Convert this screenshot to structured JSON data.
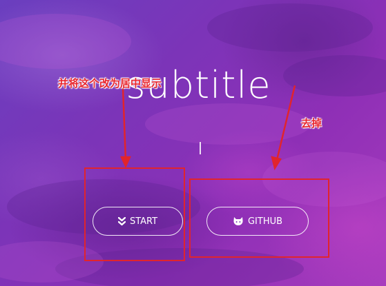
{
  "hero": {
    "subtitle": "subtitle"
  },
  "buttons": {
    "start_label": "START",
    "github_label": "GITHUB"
  },
  "annotations": {
    "center_note": "并将这个改为居中显示",
    "remove_note": "去掉",
    "color": "#e1242c"
  },
  "icons": {
    "start_icon": "double-chevron-down-icon",
    "github_icon": "github-icon"
  },
  "colors": {
    "background_primary": "#7c34b8",
    "background_accent": "#a73bbd",
    "text": "#ffffff"
  }
}
